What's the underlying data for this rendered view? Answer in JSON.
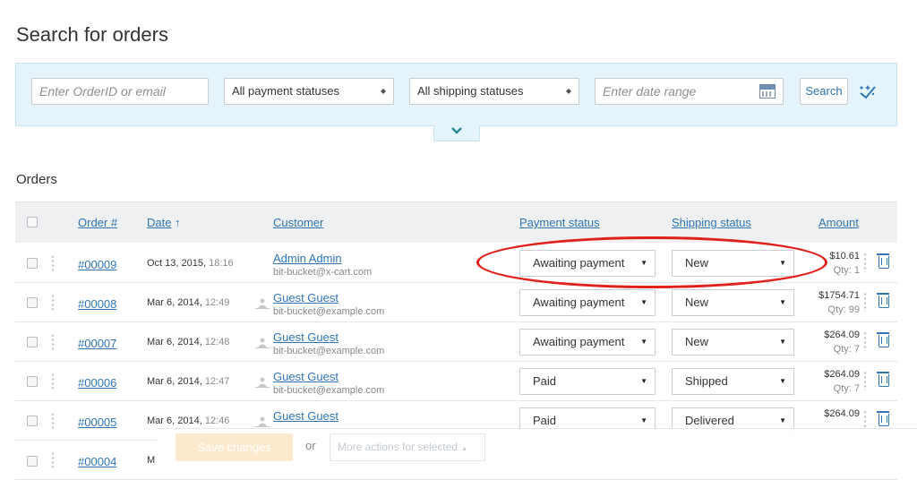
{
  "page": {
    "title": "Search for orders"
  },
  "search": {
    "order_placeholder": "Enter OrderID or email",
    "payment_select": "All payment statuses",
    "shipping_select": "All shipping statuses",
    "date_placeholder": "Enter date range",
    "search_label": "Search"
  },
  "orders": {
    "title": "Orders",
    "headers": {
      "order": "Order #",
      "date": "Date",
      "date_sort": "↑",
      "customer": "Customer",
      "payment": "Payment status",
      "shipping": "Shipping status",
      "amount": "Amount"
    },
    "rows": [
      {
        "num": "#00009",
        "date": "Oct 13, 2015,",
        "time": "18:16",
        "name": "Admin Admin",
        "email": "bit-bucket@x-cart.com",
        "payment": "Awaiting payment",
        "shipping": "New",
        "amount": "$10.61",
        "qty": "Qty: 1"
      },
      {
        "num": "#00008",
        "date": "Mar 6, 2014,",
        "time": "12:49",
        "name": "Guest Guest",
        "email": "bit-bucket@example.com",
        "payment": "Awaiting payment",
        "shipping": "New",
        "amount": "$1754.71",
        "qty": "Qty: 99"
      },
      {
        "num": "#00007",
        "date": "Mar 6, 2014,",
        "time": "12:48",
        "name": "Guest Guest",
        "email": "bit-bucket@example.com",
        "payment": "Awaiting payment",
        "shipping": "New",
        "amount": "$264.09",
        "qty": "Qty: 7"
      },
      {
        "num": "#00006",
        "date": "Mar 6, 2014,",
        "time": "12:47",
        "name": "Guest Guest",
        "email": "bit-bucket@example.com",
        "payment": "Paid",
        "shipping": "Shipped",
        "amount": "$264.09",
        "qty": "Qty: 7"
      },
      {
        "num": "#00005",
        "date": "Mar 6, 2014,",
        "time": "12:46",
        "name": "Guest Guest",
        "email": "",
        "payment": "Paid",
        "shipping": "Delivered",
        "amount": "$264.09",
        "qty": ""
      },
      {
        "num": "#00004",
        "date": "M",
        "time": "",
        "name": "",
        "email": "",
        "payment": "",
        "shipping": "",
        "amount": "",
        "qty": ""
      }
    ]
  },
  "footer": {
    "save_label": "Save changes",
    "or_label": "or",
    "more_label": "More actions for selected"
  },
  "colors": {
    "accent": "#2f74b5",
    "panel": "#e5f4fb",
    "highlight": "#e0201b"
  }
}
